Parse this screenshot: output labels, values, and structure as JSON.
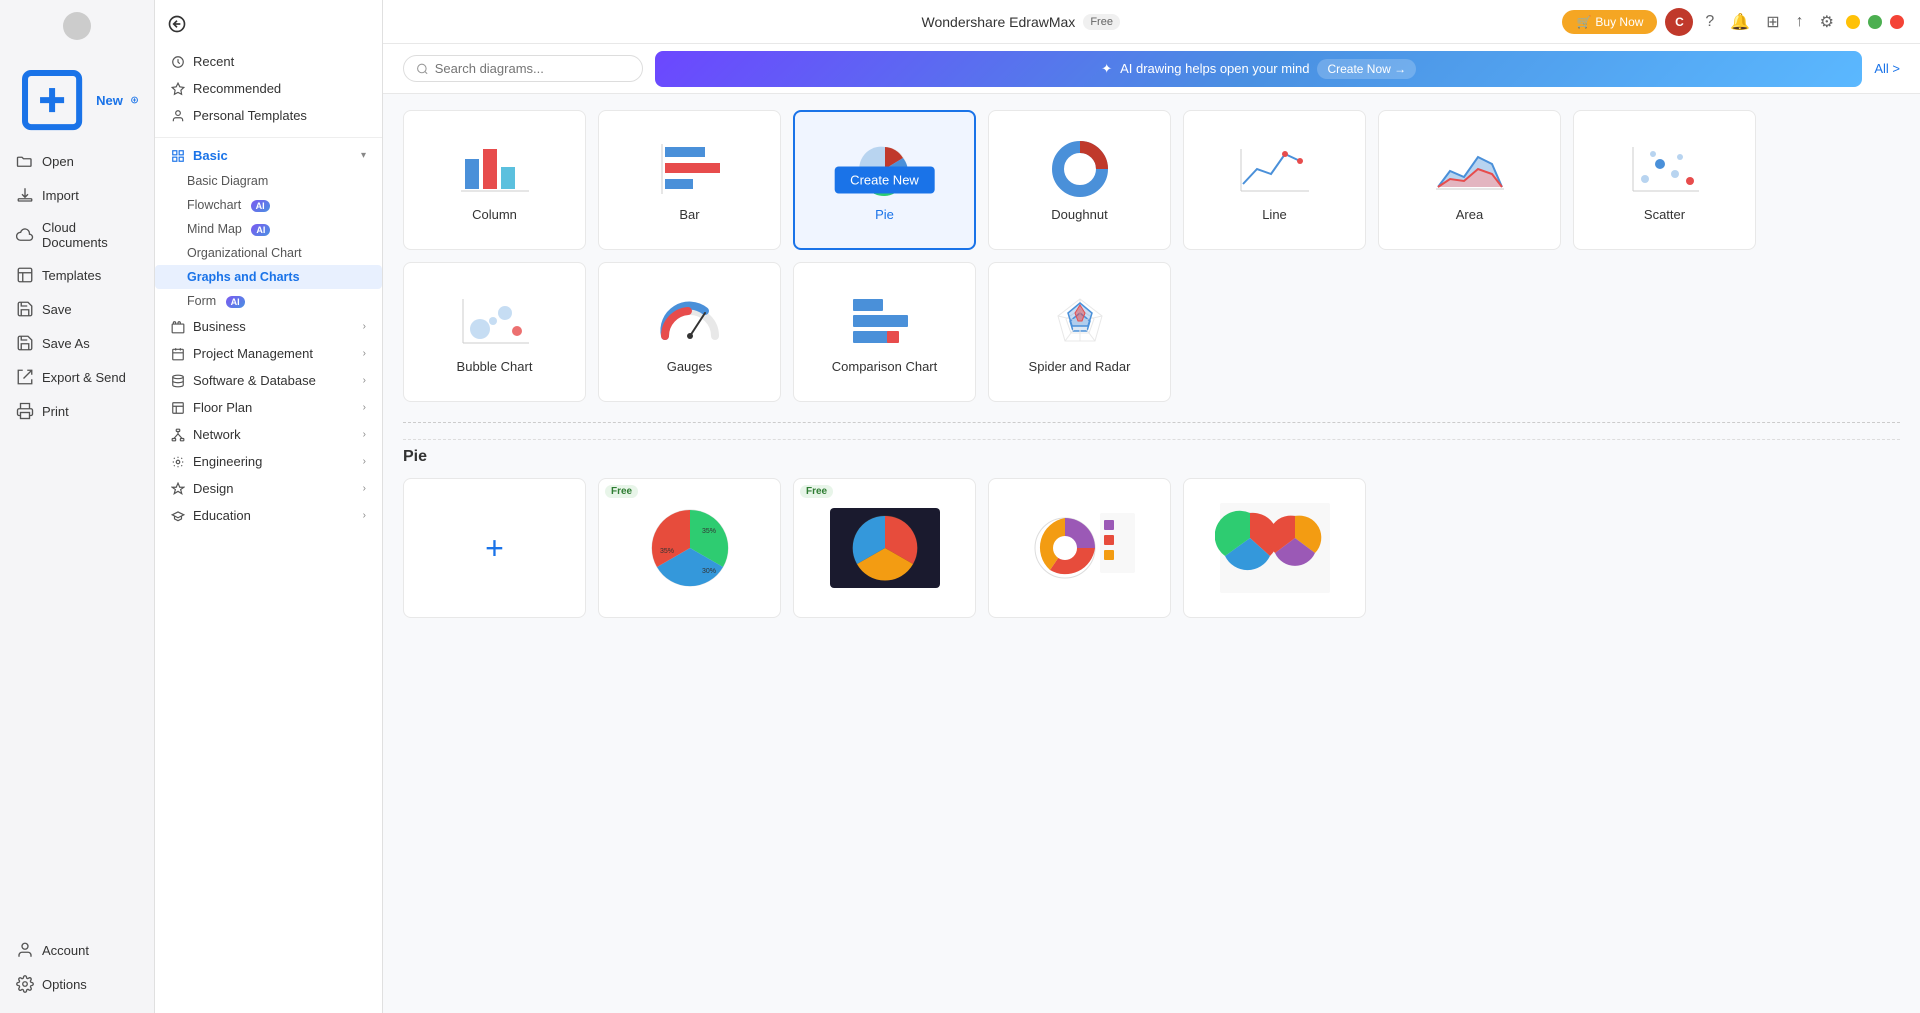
{
  "app": {
    "title": "Wondershare EdrawMax",
    "free_badge": "Free",
    "buy_now": "Buy Now"
  },
  "sidebar_narrow": {
    "back_label": "←",
    "items": [
      {
        "id": "new",
        "label": "New",
        "icon": "plus-icon",
        "active": true
      },
      {
        "id": "open",
        "label": "Open",
        "icon": "folder-icon"
      },
      {
        "id": "import",
        "label": "Import",
        "icon": "download-icon"
      },
      {
        "id": "cloud",
        "label": "Cloud Documents",
        "icon": "cloud-icon"
      },
      {
        "id": "templates",
        "label": "Templates",
        "icon": "template-icon"
      },
      {
        "id": "save",
        "label": "Save",
        "icon": "save-icon"
      },
      {
        "id": "save-as",
        "label": "Save As",
        "icon": "save-as-icon"
      },
      {
        "id": "export",
        "label": "Export & Send",
        "icon": "export-icon"
      },
      {
        "id": "print",
        "label": "Print",
        "icon": "print-icon"
      }
    ],
    "bottom": [
      {
        "id": "account",
        "label": "Account",
        "icon": "account-icon"
      },
      {
        "id": "options",
        "label": "Options",
        "icon": "options-icon"
      }
    ]
  },
  "sidebar_wide": {
    "top_items": [
      {
        "id": "recent",
        "label": "Recent"
      },
      {
        "id": "recommended",
        "label": "Recommended"
      },
      {
        "id": "personal-templates",
        "label": "Personal Templates"
      }
    ],
    "categories": [
      {
        "id": "basic",
        "label": "Basic",
        "open": true,
        "active": true,
        "children": [
          {
            "id": "basic-diagram",
            "label": "Basic Diagram",
            "ai": false
          },
          {
            "id": "flowchart",
            "label": "Flowchart",
            "ai": true
          },
          {
            "id": "mind-map",
            "label": "Mind Map",
            "ai": true
          },
          {
            "id": "org-chart",
            "label": "Organizational Chart",
            "ai": false
          },
          {
            "id": "graphs-charts",
            "label": "Graphs and Charts",
            "active": true,
            "ai": false
          },
          {
            "id": "form",
            "label": "Form",
            "ai": true
          }
        ]
      },
      {
        "id": "business",
        "label": "Business",
        "open": false
      },
      {
        "id": "project-mgmt",
        "label": "Project Management",
        "open": false
      },
      {
        "id": "software-db",
        "label": "Software & Database",
        "open": false
      },
      {
        "id": "floor-plan",
        "label": "Floor Plan",
        "open": false
      },
      {
        "id": "network",
        "label": "Network",
        "open": false
      },
      {
        "id": "engineering",
        "label": "Engineering",
        "open": false
      },
      {
        "id": "design",
        "label": "Design",
        "open": false
      },
      {
        "id": "education",
        "label": "Education",
        "open": false
      }
    ]
  },
  "toolbar": {
    "search_placeholder": "Search diagrams...",
    "ai_banner_text": "AI drawing helps open your mind",
    "create_now": "Create Now →",
    "all_label": "All >"
  },
  "charts": [
    {
      "id": "column",
      "label": "Column",
      "selected": false
    },
    {
      "id": "bar",
      "label": "Bar",
      "selected": false
    },
    {
      "id": "pie",
      "label": "Pie",
      "selected": true
    },
    {
      "id": "doughnut",
      "label": "Doughnut",
      "selected": false
    },
    {
      "id": "line",
      "label": "Line",
      "selected": false
    },
    {
      "id": "area",
      "label": "Area",
      "selected": false
    },
    {
      "id": "scatter",
      "label": "Scatter",
      "selected": false
    },
    {
      "id": "bubble",
      "label": "Bubble Chart",
      "selected": false
    },
    {
      "id": "gauges",
      "label": "Gauges",
      "selected": false
    },
    {
      "id": "comparison",
      "label": "Comparison Chart",
      "selected": false
    },
    {
      "id": "spider-radar",
      "label": "Spider and Radar",
      "selected": false
    }
  ],
  "create_new_label": "Create New",
  "templates_section_title": "Pie",
  "templates": [
    {
      "id": "add",
      "type": "add"
    },
    {
      "id": "t1",
      "type": "thumb",
      "free": true
    },
    {
      "id": "t2",
      "type": "thumb",
      "free": true
    },
    {
      "id": "t3",
      "type": "thumb",
      "free": false
    },
    {
      "id": "t4",
      "type": "thumb",
      "free": false
    }
  ],
  "window_controls": {
    "minimize": "─",
    "maximize": "□",
    "close": "✕"
  },
  "avatar_initial": "C"
}
